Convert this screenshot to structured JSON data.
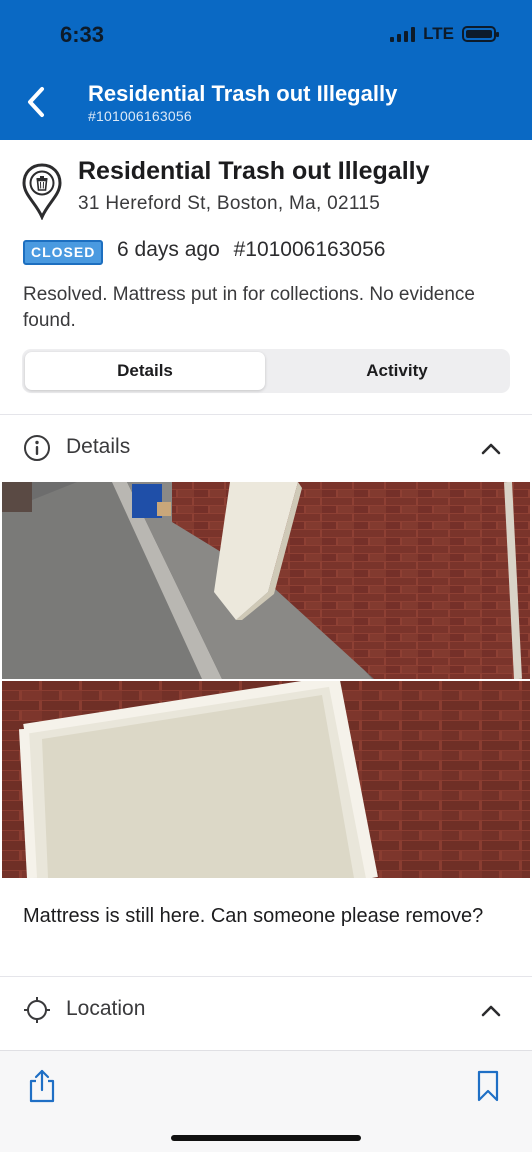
{
  "status_bar": {
    "time": "6:33",
    "network": "LTE"
  },
  "nav": {
    "title": "Residential Trash out Illegally",
    "subtitle": "#101006163056",
    "back_icon": "chevron-left-icon"
  },
  "report": {
    "category_icon": "trash-pin-icon",
    "title": "Residential Trash out Illegally",
    "address": "31 Hereford St, Boston, Ma, 02115",
    "status": "CLOSED",
    "age": "6 days ago",
    "number": "#101006163056",
    "resolution": "Resolved. Mattress put in for collections. No evidence found."
  },
  "tabs": [
    {
      "label": "Details",
      "active": true
    },
    {
      "label": "Activity",
      "active": false
    }
  ],
  "details_section": {
    "label": "Details",
    "icon": "info-icon",
    "expanded": true,
    "photos": [
      {
        "alt": "Mattress leaning against brick wall on sidewalk"
      },
      {
        "alt": "Close-up of mattress against brick wall"
      }
    ],
    "comment": "Mattress is still here.  Can someone please remove?"
  },
  "location_section": {
    "label": "Location",
    "icon": "crosshair-icon",
    "expanded": true
  },
  "toolbar": {
    "share_icon": "share-icon",
    "bookmark_icon": "bookmark-icon"
  },
  "colors": {
    "header_bg": "#0a69c4",
    "badge_bg": "#4a9ae0",
    "text_primary": "#1c1c1e"
  }
}
